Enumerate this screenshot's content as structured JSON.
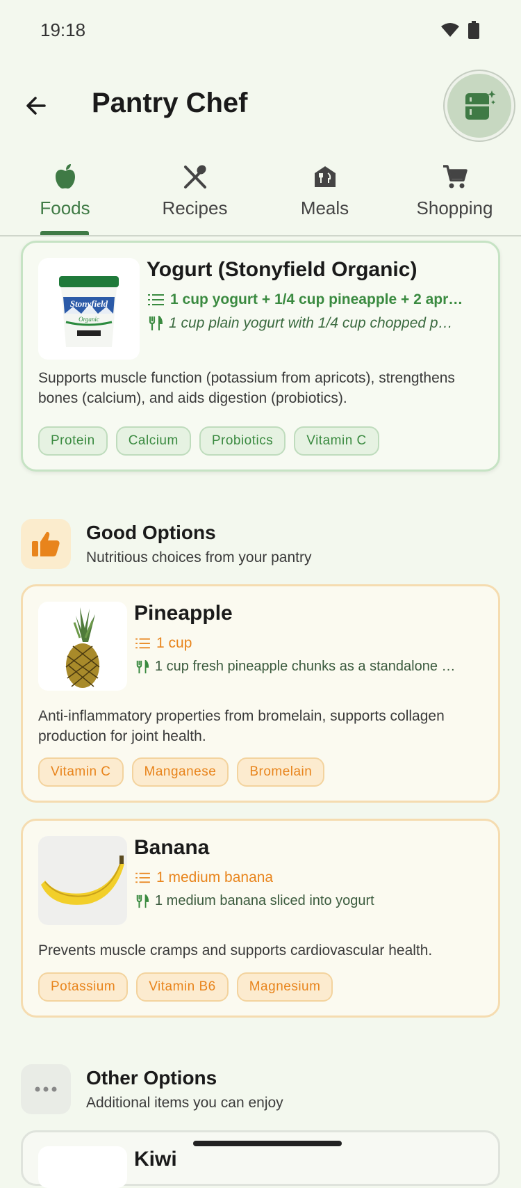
{
  "status_bar": {
    "time": "19:18"
  },
  "app_bar": {
    "title": "Pantry Chef"
  },
  "tabs": [
    {
      "label": "Foods",
      "icon": "apple-icon",
      "active": true
    },
    {
      "label": "Recipes",
      "icon": "utensils-crossed-icon",
      "active": false
    },
    {
      "label": "Meals",
      "icon": "house-utensils-icon",
      "active": false
    },
    {
      "label": "Shopping",
      "icon": "cart-icon",
      "active": false
    }
  ],
  "top_card": {
    "name": "Yogurt (Stonyfield Organic)",
    "portion": "1 cup yogurt + 1/4 cup pineapple + 2 apr…",
    "serving": "1 cup plain yogurt with 1/4 cup chopped p…",
    "description": "Supports muscle function (potassium from apricots), strengthens bones (calcium), and aids digestion (probiotics).",
    "tags": [
      "Protein",
      "Calcium",
      "Probiotics",
      "Vitamin C"
    ],
    "image_label": "Stonyfield Organic"
  },
  "good_section": {
    "title": "Good Options",
    "subtitle": "Nutritious choices from your pantry"
  },
  "good_items": [
    {
      "name": "Pineapple",
      "portion": "1 cup",
      "serving": "1 cup fresh pineapple chunks as a standalone …",
      "description": "Anti-inflammatory properties from bromelain, supports collagen production for joint health.",
      "tags": [
        "Vitamin C",
        "Manganese",
        "Bromelain"
      ]
    },
    {
      "name": "Banana",
      "portion": "1 medium banana",
      "serving": "1 medium banana sliced into yogurt",
      "description": "Prevents muscle cramps and supports cardiovascular health.",
      "tags": [
        "Potassium",
        "Vitamin B6",
        "Magnesium"
      ]
    }
  ],
  "other_section": {
    "title": "Other Options",
    "subtitle": "Additional items you can enjoy"
  },
  "other_items": [
    {
      "name": "Kiwi"
    }
  ],
  "colors": {
    "primary_green": "#3f7a45",
    "accent_orange": "#e8841c",
    "background": "#f3f8ee"
  }
}
